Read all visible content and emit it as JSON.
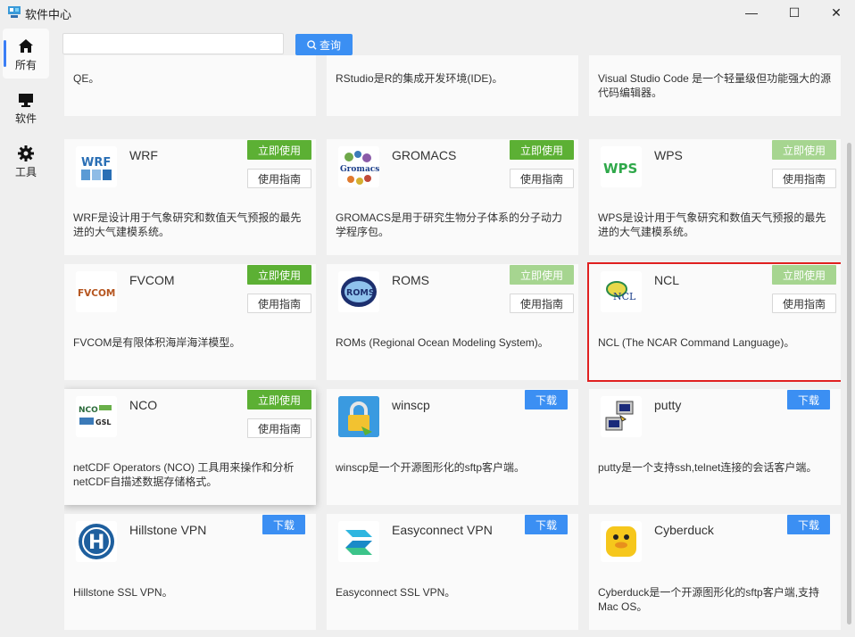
{
  "window": {
    "title": "软件中心",
    "controls": {
      "minimize": "—",
      "maximize": "☐",
      "close": "✕"
    }
  },
  "sidebar": {
    "items": [
      {
        "label": "所有",
        "icon": "home-icon",
        "active": true
      },
      {
        "label": "软件",
        "icon": "monitor-icon",
        "active": false
      },
      {
        "label": "工具",
        "icon": "gear-icon",
        "active": false
      }
    ]
  },
  "search": {
    "value": "",
    "placeholder": "",
    "button_label": "查询"
  },
  "buttons": {
    "use": "立即使用",
    "guide": "使用指南",
    "download": "下载"
  },
  "cards": [
    {
      "name": "",
      "desc": "QE。"
    },
    {
      "name": "",
      "desc": "RStudio是R的集成开发环境(IDE)。"
    },
    {
      "name": "",
      "desc": "Visual Studio Code 是一个轻量级但功能强大的源代码编辑器。"
    },
    {
      "name": "WRF",
      "logo": "WRF",
      "desc": "WRF是设计用于气象研究和数值天气预报的最先进的大气建模系统。"
    },
    {
      "name": "GROMACS",
      "logo": "Gromacs",
      "desc": "GROMACS是用于研究生物分子体系的分子动力学程序包。"
    },
    {
      "name": "WPS",
      "logo": "WPS",
      "desc": "WPS是设计用于气象研究和数值天气预报的最先进的大气建模系统。"
    },
    {
      "name": "FVCOM",
      "logo": "FVCOM",
      "desc": "FVCOM是有限体积海岸海洋模型。"
    },
    {
      "name": "ROMS",
      "logo": "ROMS",
      "desc": "ROMs (Regional Ocean Modeling System)。"
    },
    {
      "name": "NCL",
      "logo": "NCL",
      "desc": "NCL (The NCAR Command Language)。"
    },
    {
      "name": "NCO",
      "logo": "NCO",
      "logo_sub": "GSL",
      "desc": "netCDF Operators (NCO) 工具用来操作和分析netCDF自描述数据存储格式。"
    },
    {
      "name": "winscp",
      "desc": "winscp是一个开源图形化的sftp客户端。"
    },
    {
      "name": "putty",
      "desc": "putty是一个支持ssh,telnet连接的会话客户端。"
    },
    {
      "name": "Hillstone VPN",
      "logo": "H",
      "desc": "Hillstone SSL VPN。"
    },
    {
      "name": "Easyconnect VPN",
      "desc": "Easyconnect SSL VPN。"
    },
    {
      "name": "Cyberduck",
      "desc": "Cyberduck是一个开源图形化的sftp客户端,支持Mac OS。"
    }
  ],
  "colors": {
    "accent": "#3b8ff3",
    "use_green": "#5cb034",
    "use_green_disabled": "#a6d590",
    "selected_border": "#e02020"
  }
}
